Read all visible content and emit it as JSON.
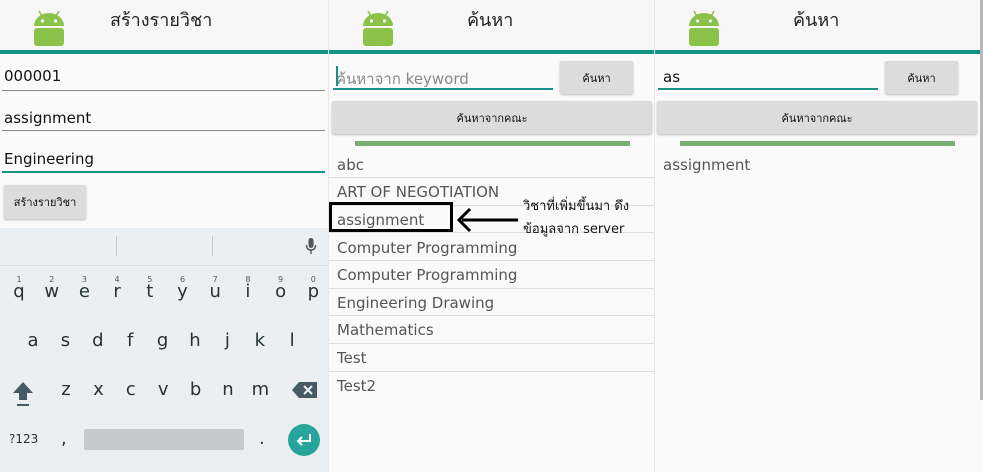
{
  "screen1": {
    "title": "สร้างรายวิชา",
    "fields": [
      "000001",
      "assignment",
      "Engineering"
    ],
    "create_button": "สร้างรายวิชา",
    "keyboard": {
      "row1": [
        {
          "k": "q",
          "n": "1"
        },
        {
          "k": "w",
          "n": "2"
        },
        {
          "k": "e",
          "n": "3"
        },
        {
          "k": "r",
          "n": "4"
        },
        {
          "k": "t",
          "n": "5"
        },
        {
          "k": "y",
          "n": "6"
        },
        {
          "k": "u",
          "n": "7"
        },
        {
          "k": "i",
          "n": "8"
        },
        {
          "k": "o",
          "n": "9"
        },
        {
          "k": "p",
          "n": "0"
        }
      ],
      "row2": [
        "a",
        "s",
        "d",
        "f",
        "g",
        "h",
        "j",
        "k",
        "l"
      ],
      "row3": [
        "z",
        "x",
        "c",
        "v",
        "b",
        "n",
        "m"
      ],
      "sym_key": "?123",
      "comma": ",",
      "period": "."
    }
  },
  "screen2": {
    "title": "ค้นหา",
    "search_placeholder": "ค้นหาจาก keyword",
    "search_button": "ค้นหา",
    "faculty_button": "ค้นหาจากคณะ",
    "list": [
      "abc",
      "ART OF NEGOTIATION",
      "assignment",
      "Computer Programming",
      "Computer Programming",
      "Engineering Drawing",
      "Mathematics",
      "Test",
      "Test2"
    ],
    "annotation": [
      "วิชาที่เพิ่มขึ้นมา ดึง",
      "ข้อมูลจาก server"
    ]
  },
  "screen3": {
    "title": "ค้นหา",
    "search_value": "as",
    "search_button": "ค้นหา",
    "faculty_button": "ค้นหาจากคณะ",
    "results": [
      "assignment"
    ]
  },
  "colors": {
    "accent": "#169287",
    "progress": "#7aaf74",
    "android": "#8bc34a"
  }
}
